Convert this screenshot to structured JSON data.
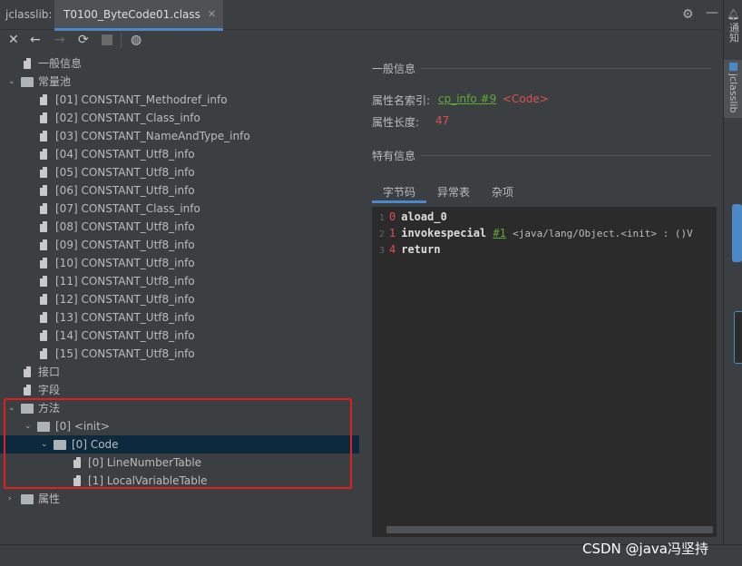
{
  "tabbar": {
    "app_label": "jclasslib:",
    "tab_title": "T0100_ByteCode01.class",
    "close_glyph": "✕"
  },
  "sidebar_right": {
    "tab1": "通知",
    "tab2": "jclasslib"
  },
  "tree": {
    "general_info": "一般信息",
    "constant_pool": "常量池",
    "constants": [
      "[01] CONSTANT_Methodref_info",
      "[02] CONSTANT_Class_info",
      "[03] CONSTANT_NameAndType_info",
      "[04] CONSTANT_Utf8_info",
      "[05] CONSTANT_Utf8_info",
      "[06] CONSTANT_Utf8_info",
      "[07] CONSTANT_Class_info",
      "[08] CONSTANT_Utf8_info",
      "[09] CONSTANT_Utf8_info",
      "[10] CONSTANT_Utf8_info",
      "[11] CONSTANT_Utf8_info",
      "[12] CONSTANT_Utf8_info",
      "[13] CONSTANT_Utf8_info",
      "[14] CONSTANT_Utf8_info",
      "[15] CONSTANT_Utf8_info"
    ],
    "interfaces": "接口",
    "fields": "字段",
    "methods": "方法",
    "method_init": "[0] <init>",
    "code": "[0] Code",
    "line_number_table": "[0] LineNumberTable",
    "local_variable_table": "[1] LocalVariableTable",
    "attributes": "属性"
  },
  "panel": {
    "general_title": "一般信息",
    "name_index_label": "属性名索引:",
    "name_index_link": "cp_info #9",
    "name_index_value": "<Code>",
    "length_label": "属性长度:",
    "length_value": "47",
    "specific_title": "特有信息",
    "tabs": [
      "字节码",
      "异常表",
      "杂项"
    ],
    "code_lines": [
      {
        "line": "1",
        "offset": "0",
        "op": "aload_0",
        "ref": "",
        "comment": ""
      },
      {
        "line": "2",
        "offset": "1",
        "op": "invokespecial",
        "ref": "#1",
        "comment": "<java/lang/Object.<init> : ()V"
      },
      {
        "line": "3",
        "offset": "4",
        "op": "return",
        "ref": "",
        "comment": ""
      }
    ]
  },
  "watermark": "CSDN @java冯坚持",
  "colors": {
    "accent": "#4a88c7",
    "link": "#62a83a",
    "red": "#e05050",
    "selection": "#0d293e",
    "highlight_box": "#e02020"
  }
}
